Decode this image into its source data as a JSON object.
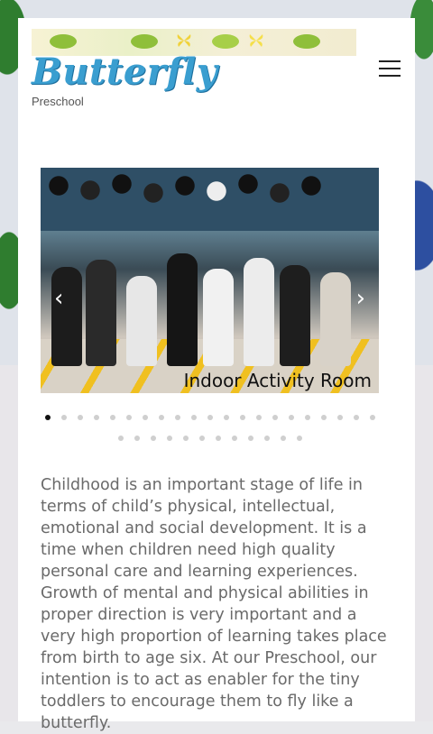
{
  "header": {
    "logo_title": "Butterfly",
    "logo_subtitle": "Preschool",
    "menu_icon": "hamburger-menu-icon"
  },
  "slider": {
    "caption": "Indoor Activity Room",
    "prev_icon": "chevron-left-icon",
    "next_icon": "chevron-right-icon",
    "prev_glyph": "‹",
    "next_glyph": "›",
    "total_slides": 33,
    "active_slide": 1
  },
  "intro": {
    "text": "Childhood is an important stage of life in terms of child’s physical, intellectual, emotional and social development. It is a time when children need high quality personal care and learning experiences. Growth of mental and physical abilities in proper direction is very important and a very high proportion of learning takes place from birth to age six. At our Preschool, our intention is to act as enabler for the tiny toddlers to encourage them to fly like a butterfly."
  },
  "colors": {
    "logo": "#3a9ed0",
    "body_text": "#6a6a6a",
    "dot_active": "#111111",
    "dot_inactive": "#cfcfcf"
  }
}
